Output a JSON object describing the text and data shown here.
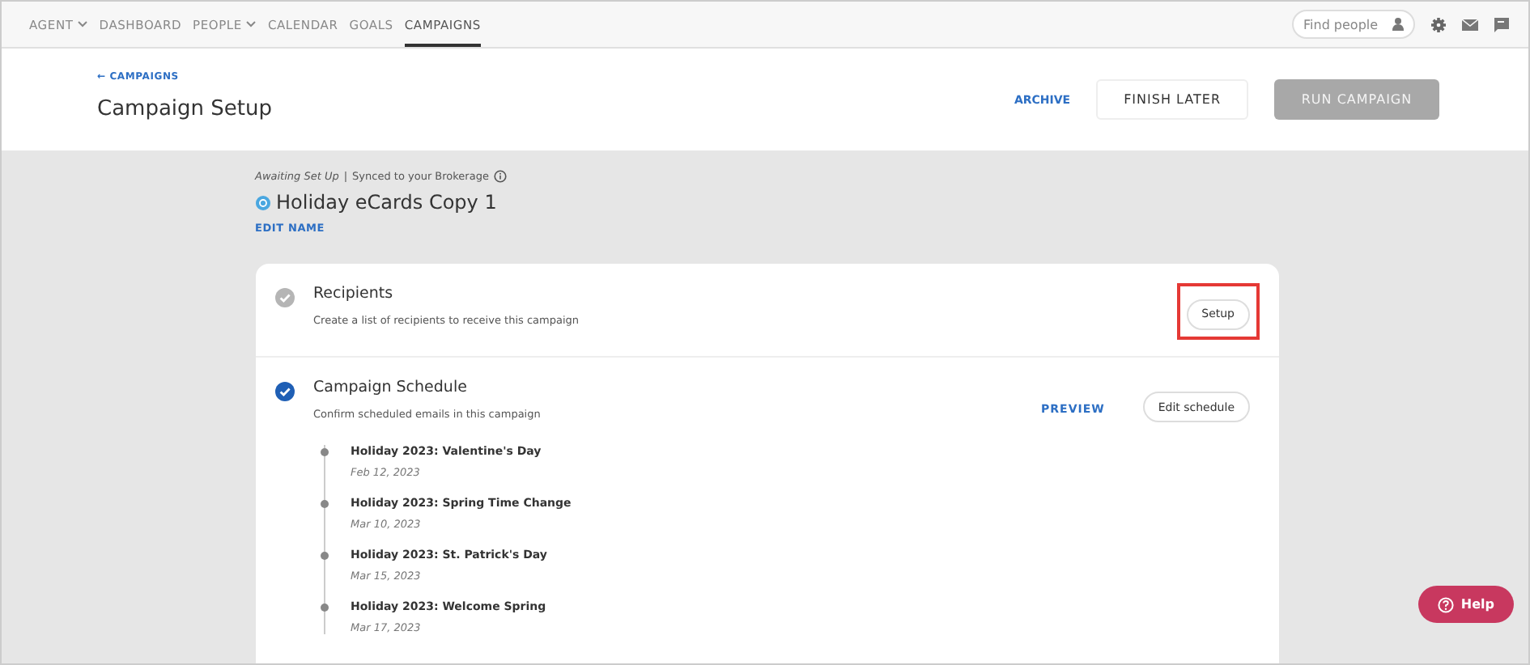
{
  "nav": {
    "items": [
      {
        "label": "AGENT",
        "dropdown": true,
        "selected": false
      },
      {
        "label": "DASHBOARD",
        "dropdown": false,
        "selected": false
      },
      {
        "label": "PEOPLE",
        "dropdown": true,
        "selected": false
      },
      {
        "label": "CALENDAR",
        "dropdown": false,
        "selected": false
      },
      {
        "label": "GOALS",
        "dropdown": false,
        "selected": false
      },
      {
        "label": "CAMPAIGNS",
        "dropdown": false,
        "selected": true
      }
    ],
    "search": {
      "placeholder": "Find people"
    }
  },
  "header": {
    "back_link": "← CAMPAIGNS",
    "title": "Campaign Setup",
    "archive": "ARCHIVE",
    "finish_later": "FINISH LATER",
    "run_campaign": {
      "label": "RUN CAMPAIGN",
      "disabled": true
    }
  },
  "campaign": {
    "status": "Awaiting Set Up",
    "separator": "|",
    "sync": "Synced to your Brokerage",
    "name": "Holiday eCards Copy 1",
    "edit_name": "EDIT NAME"
  },
  "steps": [
    {
      "title": "Recipients",
      "description": "Create a list of recipients to receive this campaign",
      "done": false,
      "button": "Setup",
      "highlighted": true
    },
    {
      "title": "Campaign Schedule",
      "description": "Confirm scheduled emails in this campaign",
      "done": true,
      "link": "PREVIEW",
      "button": "Edit schedule",
      "highlighted": false,
      "emails": [
        {
          "title": "Holiday 2023: Valentine's Day",
          "date": "Feb 12, 2023"
        },
        {
          "title": "Holiday 2023: Spring Time Change",
          "date": "Mar 10, 2023"
        },
        {
          "title": "Holiday 2023: St. Patrick's Day",
          "date": "Mar 15, 2023"
        },
        {
          "title": "Holiday 2023: Welcome Spring",
          "date": "Mar 17, 2023"
        }
      ]
    }
  ],
  "help": {
    "label": "Help"
  }
}
